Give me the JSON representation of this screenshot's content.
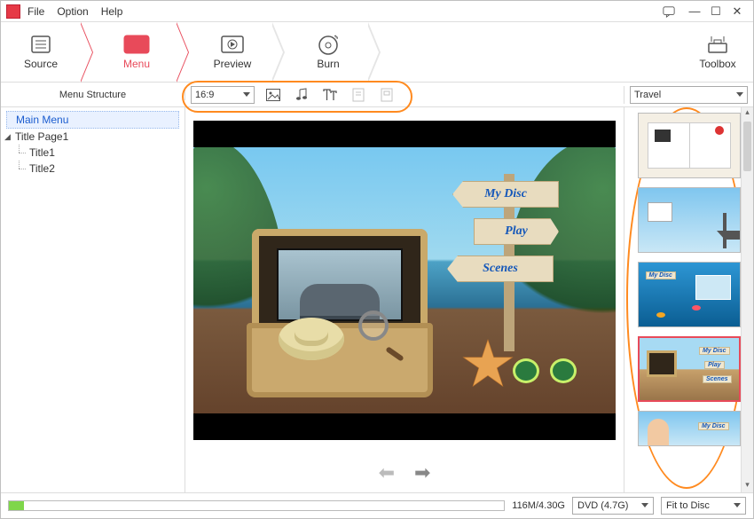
{
  "menu": {
    "file": "File",
    "option": "Option",
    "help": "Help"
  },
  "steps": {
    "source": "Source",
    "menu": "Menu",
    "preview": "Preview",
    "burn": "Burn",
    "toolbox": "Toolbox"
  },
  "toolbar": {
    "left_label": "Menu Structure",
    "aspect": "16:9",
    "template_category": "Travel"
  },
  "tree": {
    "root": "Main Menu",
    "page": "Title Page1",
    "title1": "Title1",
    "title2": "Title2"
  },
  "disc_menu": {
    "title": "My Disc",
    "play": "Play",
    "scenes": "Scenes"
  },
  "templates_mini": {
    "mydisc": "My Disc",
    "play": "Play",
    "scenes": "Scenes"
  },
  "status": {
    "size": "116M/4.30G",
    "disc_type": "DVD (4.7G)",
    "fit": "Fit to Disc"
  }
}
